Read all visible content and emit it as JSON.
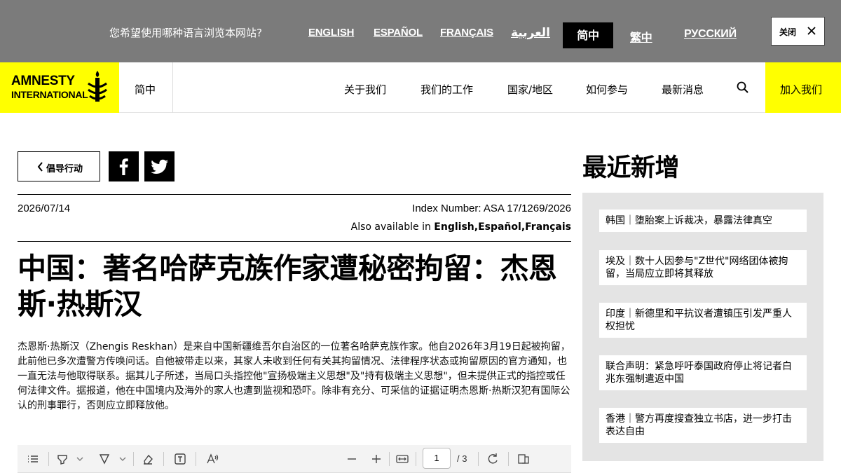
{
  "language_bar": {
    "prompt": "您希望使用哪种语言浏览本网站?",
    "options": [
      {
        "label": "ENGLISH"
      },
      {
        "label": "ESPAÑOL"
      },
      {
        "label": "FRANÇAIS"
      },
      {
        "label": "العربية"
      },
      {
        "label": "简中",
        "active": true
      },
      {
        "label": "繁中"
      },
      {
        "label": "РУССКИЙ"
      }
    ],
    "close_label": "关闭",
    "close_icon": "close-icon"
  },
  "nav": {
    "logo_line1": "AMNESTY",
    "logo_line2": "INTERNATIONAL",
    "site_language": "简中",
    "items": [
      "关于我们",
      "我们的工作",
      "国家/地区",
      "如何参与",
      "最新消息"
    ],
    "search_icon": "search-icon",
    "join_label": "加入我们"
  },
  "article": {
    "back_label": "倡导行动",
    "share": [
      "facebook-icon",
      "twitter-icon"
    ],
    "date": "2026/07/14",
    "index_number": "Index Number: ASA 17/1269/2026",
    "also_prefix": "Also available in ",
    "also_languages": "English,Español,Français",
    "headline": "中国：著名哈萨克族作家遭秘密拘留：杰恩斯·热斯汉",
    "body": "杰恩斯·热斯汉（Zhengis Reskhan）是来自中国新疆维吾尔自治区的一位著名哈萨克族作家。他自2026年3月19日起被拘留，此前他已多次遭警方传唤问话。自他被带走以来，其家人未收到任何有关其拘留情况、法律程序状态或拘留原因的官方通知，也一直无法与他取得联系。据其儿子所述，当局口头指控他\"宣扬极端主义思想\"及\"持有极端主义思想\"，但未提供正式的指控或任何法律文件。据报道，他在中国境内及海外的家人也遭到监视和恐吓。除非有充分、可采信的证据证明杰恩斯·热斯汉犯有国际公认的刑事罪行，否则应立即释放他。"
  },
  "pdf_toolbar": {
    "current_page": "1",
    "total_pages": "/ 3",
    "icons": [
      "contents-icon",
      "highlight-icon",
      "draw-icon",
      "eraser-icon",
      "text-box-icon",
      "read-aloud-icon",
      "zoom-out-icon",
      "zoom-in-icon",
      "fit-width-icon",
      "rotate-icon",
      "page-view-icon"
    ]
  },
  "sidebar": {
    "title": "最近新增",
    "items": [
      "韩国｜堕胎案上诉裁决，暴露法律真空",
      "埃及｜数十人因参与\"Z世代\"网络团体被拘留，当局应立即将其释放",
      "印度｜新德里和平抗议者遭镇压引发严重人权担忧",
      "联合声明：紧急呼吁泰国政府停止将记者白兆东强制遣返中国",
      "香港｜警方再度搜查独立书店，进一步打击表达自由"
    ]
  },
  "colors": {
    "brand_yellow": "#ffff00",
    "language_bar_bg": "#7b7b7b",
    "sidebar_bg": "#e4e4e4"
  }
}
